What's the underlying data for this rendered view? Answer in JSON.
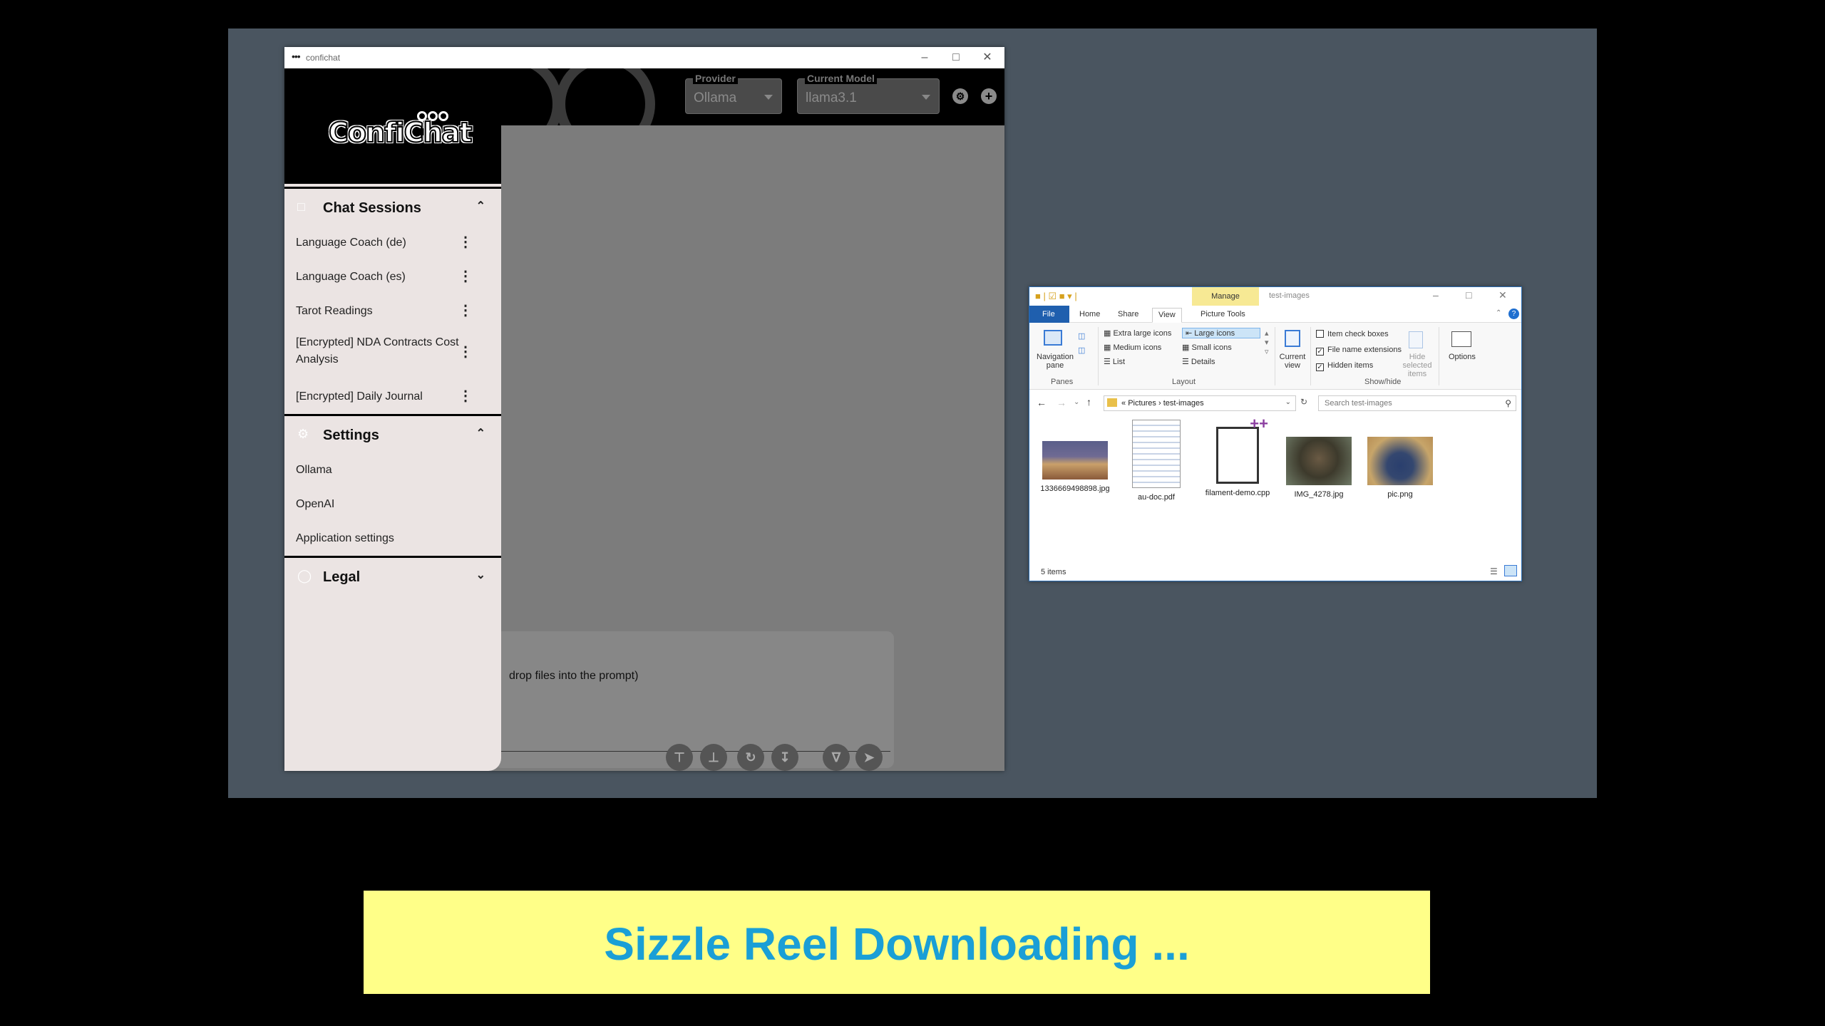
{
  "confichat": {
    "window_title": "confichat",
    "logo_text": "ConfiChat",
    "provider": {
      "label": "Provider",
      "value": "Ollama"
    },
    "model": {
      "label": "Current Model",
      "value": "llama3.1"
    },
    "sidebar": {
      "chat_sessions": {
        "title": "Chat Sessions",
        "items": [
          "Language Coach (de)",
          "Language Coach (es)",
          "Tarot Readings",
          "[Encrypted] NDA Contracts Cost Analysis",
          "[Encrypted] Daily Journal"
        ]
      },
      "settings": {
        "title": "Settings",
        "items": [
          "Ollama",
          "OpenAI",
          "Application settings"
        ]
      },
      "legal": {
        "title": "Legal"
      }
    },
    "prompt_hint": "drop files into the prompt)"
  },
  "explorer": {
    "title": "test-images",
    "context_tab": "Manage",
    "tabs": [
      "File",
      "Home",
      "Share",
      "View",
      "Picture Tools"
    ],
    "panes": {
      "navigation_pane": "Navigation pane",
      "label": "Panes"
    },
    "layout": {
      "label": "Layout",
      "options": [
        "Extra large icons",
        "Large icons",
        "Medium icons",
        "Small icons",
        "List",
        "Details"
      ],
      "selected": "Large icons"
    },
    "current_view": "Current view",
    "show_hide": {
      "label": "Show/hide",
      "item_check_boxes": "Item check boxes",
      "file_name_extensions": "File name extensions",
      "hidden_items": "Hidden items",
      "hide_selected": "Hide selected items"
    },
    "options": "Options",
    "breadcrumb": [
      "Pictures",
      "test-images"
    ],
    "search_placeholder": "Search test-images",
    "files": [
      {
        "name": "1336669498898.jpg"
      },
      {
        "name": "au-doc.pdf"
      },
      {
        "name": "filament-demo.cpp"
      },
      {
        "name": "IMG_4278.jpg"
      },
      {
        "name": "pic.png"
      }
    ],
    "status": "5 items"
  },
  "banner_text": "Sizzle Reel Downloading ..."
}
